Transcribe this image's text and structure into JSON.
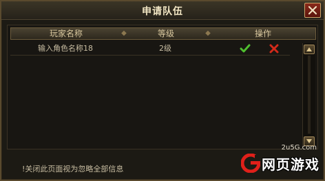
{
  "window": {
    "title": "申请队伍"
  },
  "table": {
    "headers": [
      "玩家名称",
      "等级",
      "操作"
    ],
    "rows": [
      {
        "name": "输入角色名称18",
        "level": "2级"
      }
    ]
  },
  "footer": {
    "notice": "!关闭此页面视为忽略全部信息"
  },
  "watermark": {
    "site": "2u5G.com",
    "text": "网页游戏"
  },
  "colors": {
    "accept": "#4fbf2f",
    "reject": "#d42a1a",
    "title": "#f2e6c4"
  }
}
